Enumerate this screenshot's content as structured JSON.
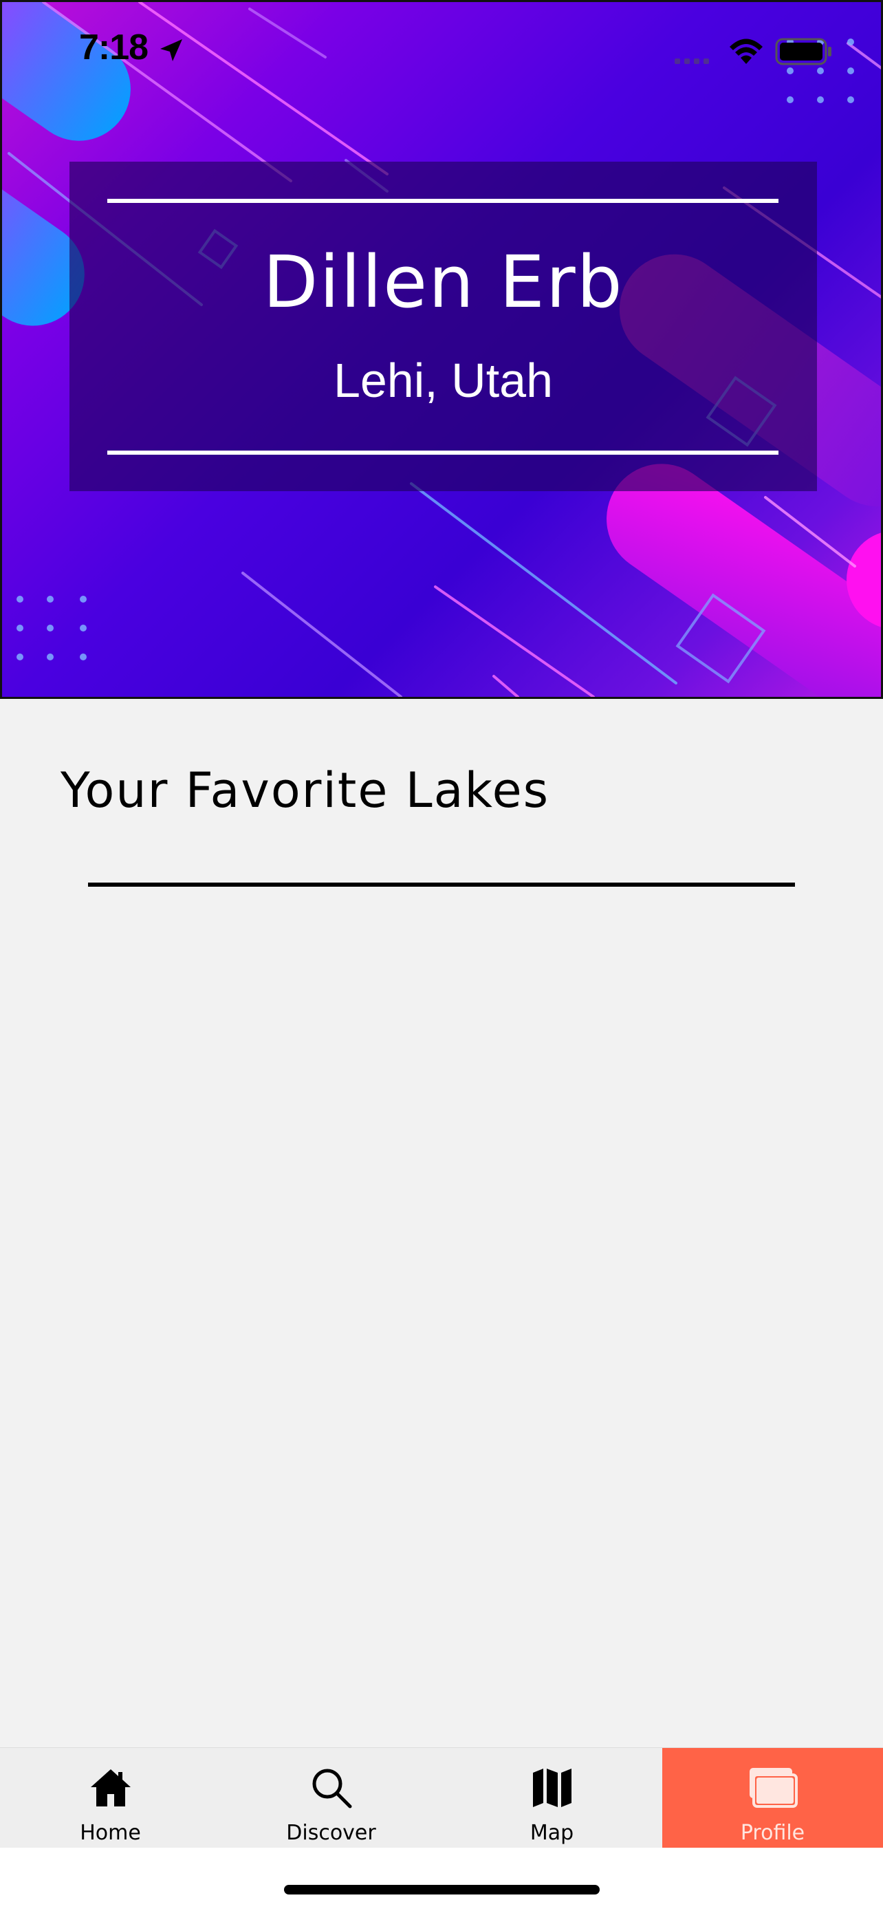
{
  "status_bar": {
    "time": "7:18",
    "icons": [
      "location-arrow-icon",
      "cellular-signal-icon",
      "wifi-icon",
      "battery-icon"
    ]
  },
  "profile": {
    "name": "Dillen Erb",
    "location": "Lehi, Utah"
  },
  "favorites": {
    "title": "Your Favorite Lakes",
    "items": []
  },
  "tab_bar": {
    "tabs": [
      {
        "label": "Home",
        "icon": "home-icon",
        "active": false
      },
      {
        "label": "Discover",
        "icon": "search-icon",
        "active": false
      },
      {
        "label": "Map",
        "icon": "map-icon",
        "active": false
      },
      {
        "label": "Profile",
        "icon": "profile-cards-icon",
        "active": true
      }
    ],
    "active_color": "#ff6347"
  }
}
